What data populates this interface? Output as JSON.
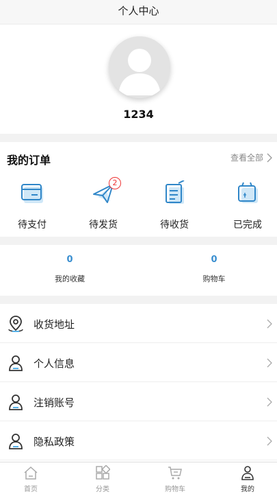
{
  "header": {
    "title": "个人中心"
  },
  "profile": {
    "username": "1234",
    "avatar_icon": "default-avatar-icon"
  },
  "orders": {
    "title": "我的订单",
    "view_all": "查看全部",
    "items": [
      {
        "label": "待支付",
        "icon": "wallet-icon"
      },
      {
        "label": "待发货",
        "icon": "paper-plane-icon",
        "badge": "2"
      },
      {
        "label": "待收货",
        "icon": "clipboard-icon"
      },
      {
        "label": "已完成",
        "icon": "completed-box-icon"
      }
    ]
  },
  "stats": [
    {
      "value": "0",
      "label": "我的收藏"
    },
    {
      "value": "0",
      "label": "购物车"
    }
  ],
  "menu": [
    {
      "label": "收货地址",
      "icon": "location-pin-icon"
    },
    {
      "label": "个人信息",
      "icon": "user-icon"
    },
    {
      "label": "注销账号",
      "icon": "user-icon"
    },
    {
      "label": "隐私政策",
      "icon": "user-icon"
    }
  ],
  "tabbar": [
    {
      "label": "首页",
      "icon": "home-icon",
      "active": false
    },
    {
      "label": "分类",
      "icon": "category-grid-icon",
      "active": false
    },
    {
      "label": "购物车",
      "icon": "cart-icon",
      "active": false
    },
    {
      "label": "我的",
      "icon": "user-icon",
      "active": true
    }
  ],
  "colors": {
    "accent": "#3a8fd0",
    "badge": "#e33333",
    "background": "#f2f2f2"
  }
}
